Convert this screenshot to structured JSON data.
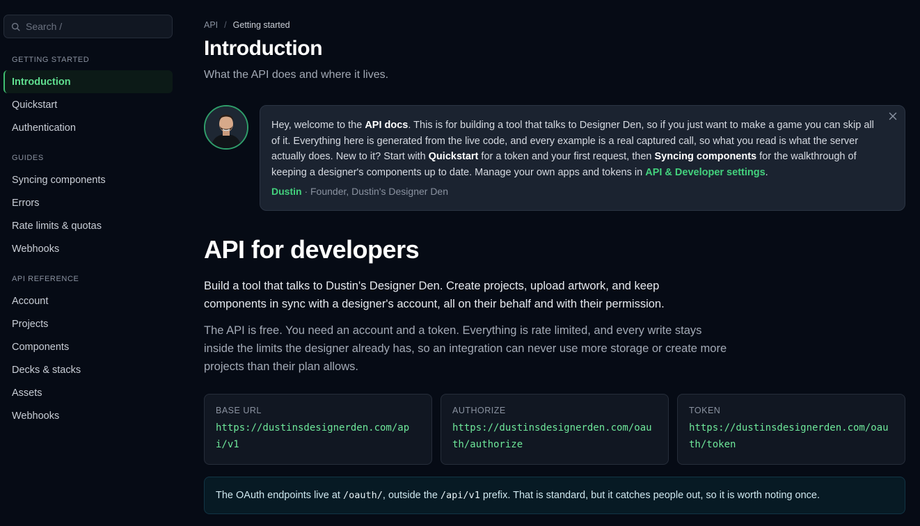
{
  "sidebar": {
    "search_placeholder": "Search  /",
    "sections": [
      {
        "heading": "GETTING STARTED",
        "items": [
          "Introduction",
          "Quickstart",
          "Authentication"
        ]
      },
      {
        "heading": "GUIDES",
        "items": [
          "Syncing components",
          "Errors",
          "Rate limits & quotas",
          "Webhooks"
        ]
      },
      {
        "heading": "API REFERENCE",
        "items": [
          "Account",
          "Projects",
          "Components",
          "Decks & stacks",
          "Assets",
          "Webhooks"
        ]
      }
    ],
    "active_item": "Introduction"
  },
  "breadcrumb": {
    "root": "API",
    "separator": "/",
    "current": "Getting started"
  },
  "page": {
    "title": "Introduction",
    "subtitle": "What the API does and where it lives."
  },
  "welcome": {
    "t1": "Hey, welcome to the ",
    "b1": "API docs",
    "t2": ". This is for building a tool that talks to Designer Den, so if you just want to make a game you can skip all of it. Everything here is generated from the live code, and every example is a real captured call, so what you read is what the server actually does. New to it? Start with ",
    "b2": "Quickstart",
    "t3": " for a token and your first request, then ",
    "b3": "Syncing components",
    "t4": " for the walkthrough of keeping a designer's components up to date. Manage your own apps and tokens in ",
    "link": "API & Developer settings",
    "t5": ".",
    "author": "Dustin",
    "author_role": " · Founder, Dustin's Designer Den"
  },
  "section": {
    "title": "API for developers",
    "lead": "Build a tool that talks to Dustin's Designer Den. Create projects, upload artwork, and keep components in sync with a designer's account, all on their behalf and with their permission.",
    "body": "The API is free. You need an account and a token. Everything is rate limited, and every write stays inside the limits the designer already has, so an integration can never use more storage or create more projects than their plan allows."
  },
  "cards": [
    {
      "label": "BASE URL",
      "value": "https://dustinsdesignerden.com/api/v1"
    },
    {
      "label": "AUTHORIZE",
      "value": "https://dustinsdesignerden.com/oauth/authorize"
    },
    {
      "label": "TOKEN",
      "value": "https://dustinsdesignerden.com/oauth/token"
    }
  ],
  "note": {
    "t1": "The OAuth endpoints live at ",
    "code1": "/oauth/",
    "t2": ", outside the ",
    "code2": "/api/v1",
    "t3": " prefix. That is standard, but it catches people out, so it is worth noting once."
  },
  "colors": {
    "accent": "#43d17d",
    "background": "#060b15",
    "bubble": "#1b2330",
    "note_bg": "#071a24"
  },
  "icons": {
    "search": "search-icon",
    "close": "close-icon",
    "avatar": "avatar"
  }
}
